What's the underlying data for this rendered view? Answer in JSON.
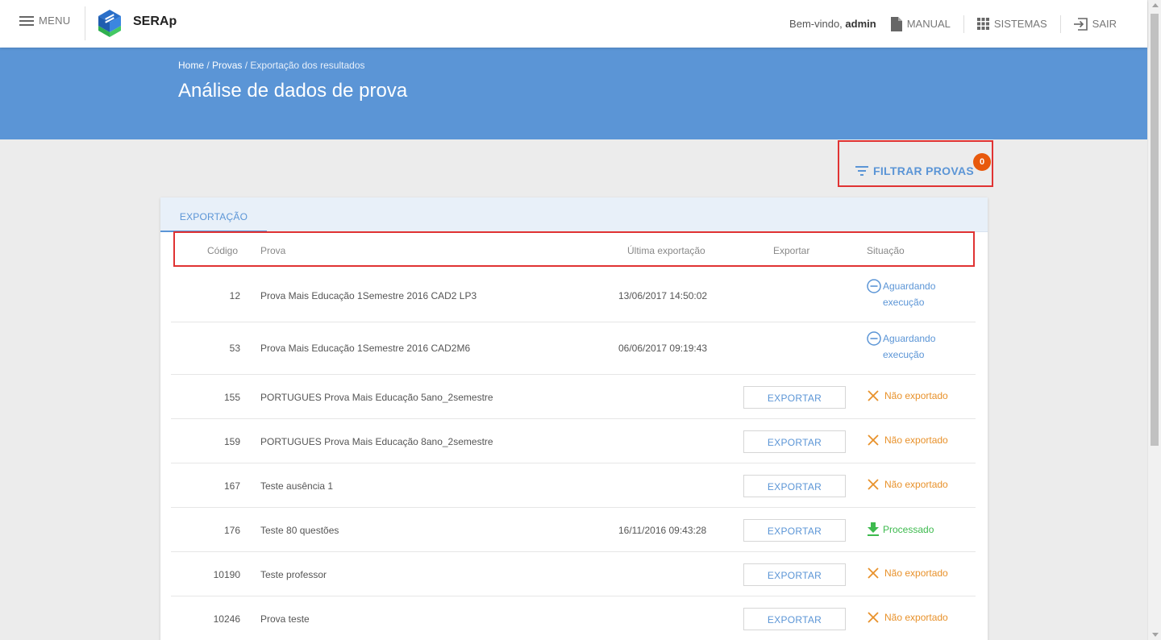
{
  "header": {
    "menu_label": "MENU",
    "brand": "SERAp",
    "welcome_prefix": "Bem-vindo, ",
    "welcome_user": "admin",
    "manual_label": "MANUAL",
    "sistemas_label": "SISTEMAS",
    "sair_label": "SAIR"
  },
  "hero": {
    "breadcrumb": [
      "Home",
      "Provas",
      "Exportação dos resultados"
    ],
    "breadcrumb_sep": " / ",
    "title": "Análise de dados de prova",
    "background": "#5b95d6"
  },
  "filter": {
    "label": "FILTRAR PROVAS",
    "badge": "0",
    "badge_color": "#e8590c"
  },
  "tabs": [
    {
      "label": "EXPORTAÇÃO",
      "active": true
    }
  ],
  "table": {
    "columns": {
      "codigo": "Código",
      "prova": "Prova",
      "ultima": "Última exportação",
      "exportar": "Exportar",
      "situacao": "Situação"
    },
    "export_button_label": "EXPORTAR",
    "rows": [
      {
        "codigo": "12",
        "prova": "Prova Mais Educação 1Semestre 2016 CAD2 LP3",
        "ultima": "13/06/2017 14:50:02",
        "exportar": false,
        "status": "aguardando",
        "status_text": "Aguardando execução"
      },
      {
        "codigo": "53",
        "prova": "Prova Mais Educação 1Semestre 2016 CAD2M6",
        "ultima": "06/06/2017 09:19:43",
        "exportar": false,
        "status": "aguardando",
        "status_text": "Aguardando execução"
      },
      {
        "codigo": "155",
        "prova": "PORTUGUES Prova Mais Educação 5ano_2semestre",
        "ultima": "",
        "exportar": true,
        "status": "nao",
        "status_text": "Não exportado"
      },
      {
        "codigo": "159",
        "prova": "PORTUGUES Prova Mais Educação 8ano_2semestre",
        "ultima": "",
        "exportar": true,
        "status": "nao",
        "status_text": "Não exportado"
      },
      {
        "codigo": "167",
        "prova": "Teste ausência 1",
        "ultima": "",
        "exportar": true,
        "status": "nao",
        "status_text": "Não exportado"
      },
      {
        "codigo": "176",
        "prova": "Teste 80 questões",
        "ultima": "16/11/2016 09:43:28",
        "exportar": true,
        "status": "processado",
        "status_text": "Processado"
      },
      {
        "codigo": "10190",
        "prova": "Teste professor",
        "ultima": "",
        "exportar": true,
        "status": "nao",
        "status_text": "Não exportado"
      },
      {
        "codigo": "10246",
        "prova": "Prova teste",
        "ultima": "",
        "exportar": true,
        "status": "nao",
        "status_text": "Não exportado"
      }
    ]
  },
  "colors": {
    "accent": "#5b95d6",
    "warning": "#e8912a",
    "success": "#3dba4e",
    "highlight_border": "#e03333"
  }
}
